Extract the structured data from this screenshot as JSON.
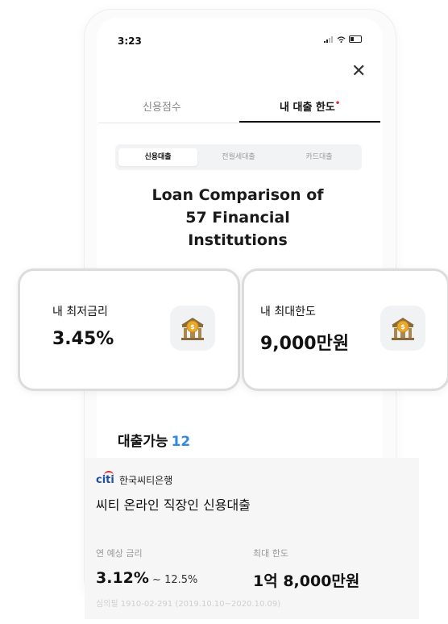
{
  "status": {
    "time": "3:23"
  },
  "tabs": [
    {
      "label": "신용점수",
      "active": false
    },
    {
      "label": "내 대출 한도",
      "active": true,
      "dot": "•"
    }
  ],
  "segments": [
    {
      "label": "신용대출",
      "active": true
    },
    {
      "label": "전월세대출",
      "active": false
    },
    {
      "label": "카드대출",
      "active": false
    }
  ],
  "headline": {
    "line1": "Loan Comparison of",
    "line2": "57 Financial",
    "line3": "Institutions"
  },
  "cards": {
    "lowest_rate": {
      "label": "내 최저금리",
      "value": "3.45%",
      "icon": "bank-icon"
    },
    "max_limit": {
      "label": "내 최대한도",
      "value": "9,000만원",
      "icon": "bank-icon"
    }
  },
  "available": {
    "label": "대출가능",
    "count": "12"
  },
  "loan": {
    "logo": "citi",
    "bank": "한국씨티은행",
    "product": "씨티 온라인 직장인 신용대출",
    "rate_label": "연 예상 금리",
    "rate_value": "3.12%",
    "rate_range": " ~ 12.5%",
    "limit_label": "최대 한도",
    "limit_value": "1억 8,000만원",
    "disclaimer": "심의필 1910-02-291 (2019.10.10~2020.10.09)"
  },
  "colors": {
    "accent_blue": "#2f87e6",
    "dot_red": "#e0272e",
    "citi_blue": "#1b4fa8",
    "coin_gold": "#e8a92c"
  }
}
